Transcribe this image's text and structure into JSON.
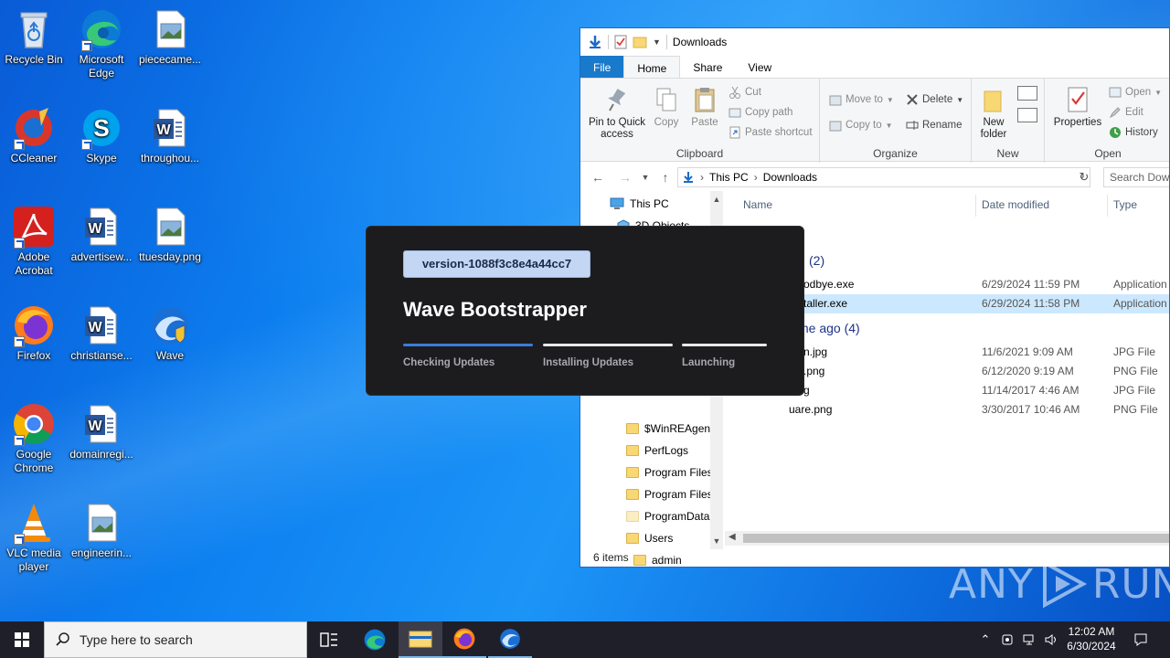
{
  "desktop": {
    "icons": [
      {
        "label": "Recycle Bin",
        "icon": "recycle-bin-icon"
      },
      {
        "label": "Microsoft Edge",
        "icon": "edge-icon"
      },
      {
        "label": "piececame...",
        "icon": "image-file-icon"
      },
      {
        "label": "CCleaner",
        "icon": "ccleaner-icon"
      },
      {
        "label": "Skype",
        "icon": "skype-icon"
      },
      {
        "label": "throughou...",
        "icon": "word-doc-icon"
      },
      {
        "label": "Adobe Acrobat",
        "icon": "acrobat-icon"
      },
      {
        "label": "advertisew...",
        "icon": "word-doc-icon"
      },
      {
        "label": "ttuesday.png",
        "icon": "image-file-icon"
      },
      {
        "label": "Firefox",
        "icon": "firefox-icon"
      },
      {
        "label": "christianse...",
        "icon": "word-doc-icon"
      },
      {
        "label": "Wave",
        "icon": "wave-icon"
      },
      {
        "label": "Google Chrome",
        "icon": "chrome-icon"
      },
      {
        "label": "domainregi...",
        "icon": "word-doc-icon"
      },
      {
        "label": "VLC media player",
        "icon": "vlc-icon"
      },
      {
        "label": "engineerin...",
        "icon": "image-file-icon"
      }
    ]
  },
  "explorer": {
    "title": "Downloads",
    "tabs": [
      "File",
      "Home",
      "Share",
      "View"
    ],
    "ribbon": {
      "clipboard": {
        "label": "Clipboard",
        "pin": "Pin to Quick access",
        "copy": "Copy",
        "paste": "Paste",
        "cut": "Cut",
        "copy_path": "Copy path",
        "paste_shortcut": "Paste shortcut"
      },
      "organize": {
        "label": "Organize",
        "move_to": "Move to",
        "copy_to": "Copy to",
        "delete": "Delete",
        "rename": "Rename"
      },
      "new": {
        "label": "New",
        "new_folder": "New folder"
      },
      "open": {
        "label": "Open",
        "properties": "Properties",
        "open": "Open",
        "edit": "Edit",
        "history": "History"
      }
    },
    "address": {
      "crumbs": [
        "This PC",
        "Downloads"
      ],
      "search_placeholder": "Search Downloads"
    },
    "nav": {
      "this_pc": "This PC",
      "objects_3d": "3D Objects",
      "folders": [
        "$WinREAgent",
        "PerfLogs",
        "Program Files",
        "Program Files",
        "ProgramData",
        "Users"
      ],
      "admin": "admin"
    },
    "columns": {
      "name": "Name",
      "date": "Date modified",
      "type": "Type"
    },
    "groups": [
      {
        "label": "(2)"
      },
      {
        "label": "me ago (4)"
      }
    ],
    "files": [
      {
        "name": "odbye.exe",
        "date": "6/29/2024 11:59 PM",
        "type": "Application",
        "selected": false
      },
      {
        "name": "taller.exe",
        "date": "6/29/2024 11:58 PM",
        "type": "Application",
        "selected": true
      },
      {
        "name": "n.jpg",
        "date": "11/6/2021 9:09 AM",
        "type": "JPG File",
        "selected": false
      },
      {
        "name": ".png",
        "date": "6/12/2020 9:19 AM",
        "type": "PNG File",
        "selected": false
      },
      {
        "name": "g",
        "date": "11/14/2017 4:46 AM",
        "type": "JPG File",
        "selected": false
      },
      {
        "name": "uare.png",
        "date": "3/30/2017 10:46 AM",
        "type": "PNG File",
        "selected": false
      }
    ],
    "status": "6 items"
  },
  "bootstrapper": {
    "version": "version-1088f3c8e4a44cc7",
    "title": "Wave Bootstrapper",
    "steps": [
      {
        "label": "Checking Updates",
        "active": true
      },
      {
        "label": "Installing Updates",
        "active": false
      },
      {
        "label": "Launching",
        "active": false
      }
    ],
    "accent": "#3b7dd8"
  },
  "watermark": {
    "text_left": "ANY",
    "text_right": "RUN"
  },
  "taskbar": {
    "search_placeholder": "Type here to search",
    "time": "12:02 AM",
    "date": "6/30/2024"
  }
}
